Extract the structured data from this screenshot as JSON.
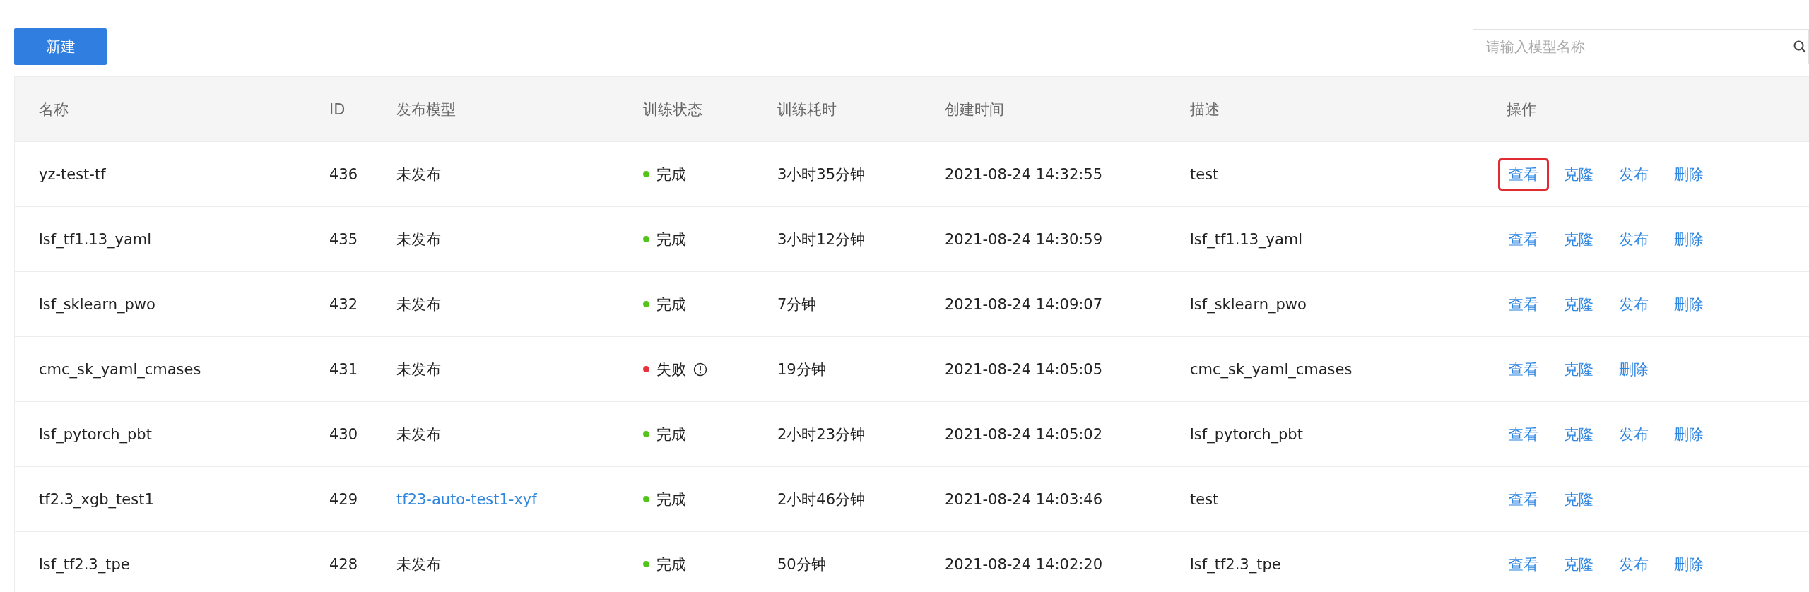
{
  "toolbar": {
    "create_button": "新建",
    "search": {
      "placeholder": "请输入模型名称"
    }
  },
  "table": {
    "columns": [
      "名称",
      "ID",
      "发布模型",
      "训练状态",
      "训练耗时",
      "创建时间",
      "描述",
      "操作"
    ],
    "rows": [
      {
        "name": "yz-test-tf",
        "id": "436",
        "published": {
          "text": "未发布",
          "linked": false
        },
        "status": {
          "label": "完成",
          "kind": "success",
          "color": "#52c41a"
        },
        "duration": "3小时35分钟",
        "created": "2021-08-24 14:32:55",
        "description": "test",
        "actions": [
          {
            "label": "查看",
            "highlighted": true
          },
          {
            "label": "克隆",
            "highlighted": false
          },
          {
            "label": "发布",
            "highlighted": false
          },
          {
            "label": "删除",
            "highlighted": false
          }
        ]
      },
      {
        "name": "lsf_tf1.13_yaml",
        "id": "435",
        "published": {
          "text": "未发布",
          "linked": false
        },
        "status": {
          "label": "完成",
          "kind": "success",
          "color": "#52c41a"
        },
        "duration": "3小时12分钟",
        "created": "2021-08-24 14:30:59",
        "description": "lsf_tf1.13_yaml",
        "actions": [
          {
            "label": "查看",
            "highlighted": false
          },
          {
            "label": "克隆",
            "highlighted": false
          },
          {
            "label": "发布",
            "highlighted": false
          },
          {
            "label": "删除",
            "highlighted": false
          }
        ]
      },
      {
        "name": "lsf_sklearn_pwo",
        "id": "432",
        "published": {
          "text": "未发布",
          "linked": false
        },
        "status": {
          "label": "完成",
          "kind": "success",
          "color": "#52c41a"
        },
        "duration": "7分钟",
        "created": "2021-08-24 14:09:07",
        "description": "lsf_sklearn_pwo",
        "actions": [
          {
            "label": "查看",
            "highlighted": false
          },
          {
            "label": "克隆",
            "highlighted": false
          },
          {
            "label": "发布",
            "highlighted": false
          },
          {
            "label": "删除",
            "highlighted": false
          }
        ]
      },
      {
        "name": "cmc_sk_yaml_cmases",
        "id": "431",
        "published": {
          "text": "未发布",
          "linked": false
        },
        "status": {
          "label": "失败",
          "kind": "failed",
          "color": "#e8313f"
        },
        "duration": "19分钟",
        "created": "2021-08-24 14:05:05",
        "description": "cmc_sk_yaml_cmases",
        "actions": [
          {
            "label": "查看",
            "highlighted": false
          },
          {
            "label": "克隆",
            "highlighted": false
          },
          {
            "label": "删除",
            "highlighted": false
          }
        ]
      },
      {
        "name": "lsf_pytorch_pbt",
        "id": "430",
        "published": {
          "text": "未发布",
          "linked": false
        },
        "status": {
          "label": "完成",
          "kind": "success",
          "color": "#52c41a"
        },
        "duration": "2小时23分钟",
        "created": "2021-08-24 14:05:02",
        "description": "lsf_pytorch_pbt",
        "actions": [
          {
            "label": "查看",
            "highlighted": false
          },
          {
            "label": "克隆",
            "highlighted": false
          },
          {
            "label": "发布",
            "highlighted": false
          },
          {
            "label": "删除",
            "highlighted": false
          }
        ]
      },
      {
        "name": "tf2.3_xgb_test1",
        "id": "429",
        "published": {
          "text": "tf23-auto-test1-xyf",
          "linked": true
        },
        "status": {
          "label": "完成",
          "kind": "success",
          "color": "#52c41a"
        },
        "duration": "2小时46分钟",
        "created": "2021-08-24 14:03:46",
        "description": "test",
        "actions": [
          {
            "label": "查看",
            "highlighted": false
          },
          {
            "label": "克隆",
            "highlighted": false
          }
        ]
      },
      {
        "name": "lsf_tf2.3_tpe",
        "id": "428",
        "published": {
          "text": "未发布",
          "linked": false
        },
        "status": {
          "label": "完成",
          "kind": "success",
          "color": "#52c41a"
        },
        "duration": "50分钟",
        "created": "2021-08-24 14:02:20",
        "description": "lsf_tf2.3_tpe",
        "actions": [
          {
            "label": "查看",
            "highlighted": false
          },
          {
            "label": "克隆",
            "highlighted": false
          },
          {
            "label": "发布",
            "highlighted": false
          },
          {
            "label": "删除",
            "highlighted": false
          }
        ]
      }
    ]
  }
}
